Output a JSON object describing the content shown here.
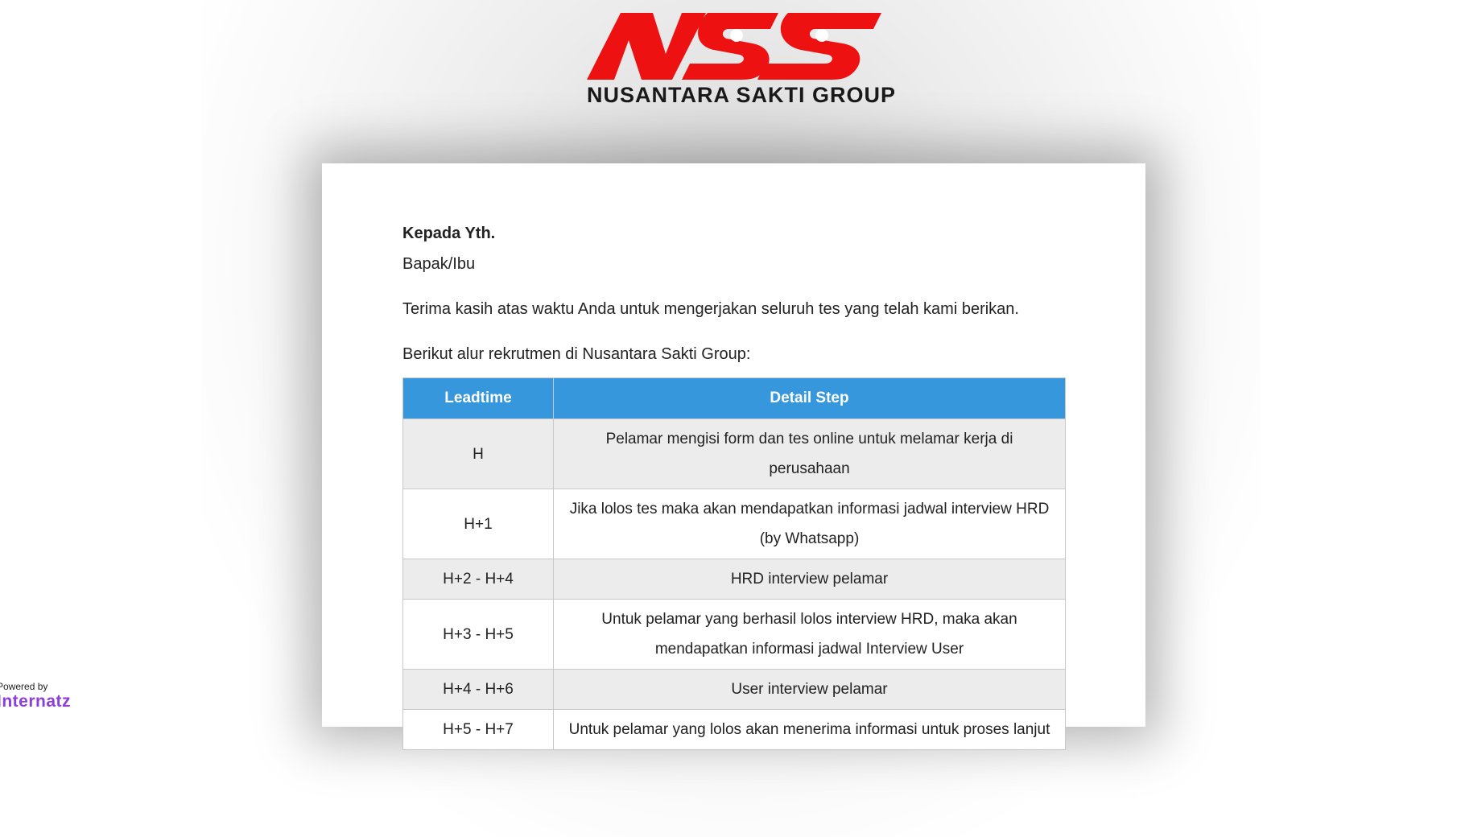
{
  "logo": {
    "mark": "NSS",
    "name": "NUSANTARA SAKTI GROUP",
    "color": "#ee1111"
  },
  "letter": {
    "greeting": "Kepada Yth.",
    "recipient": "Bapak/Ibu",
    "thanks": "Terima kasih atas waktu Anda untuk mengerjakan seluruh tes yang telah kami berikan.",
    "intro": "Berikut alur rekrutmen di Nusantara Sakti Group:"
  },
  "table": {
    "header_color": "#3797dc",
    "headers": [
      "Leadtime",
      "Detail Step"
    ],
    "rows": [
      {
        "leadtime": "H",
        "step": "Pelamar mengisi form dan tes online untuk melamar kerja di perusahaan"
      },
      {
        "leadtime": "H+1",
        "step": "Jika lolos tes maka akan mendapatkan informasi jadwal interview HRD (by Whatsapp)"
      },
      {
        "leadtime": "H+2 - H+4",
        "step": "HRD interview pelamar"
      },
      {
        "leadtime": "H+3 - H+5",
        "step": "Untuk pelamar yang berhasil lolos interview HRD, maka akan mendapatkan informasi jadwal Interview User"
      },
      {
        "leadtime": "H+4 - H+6",
        "step": "User interview pelamar"
      },
      {
        "leadtime": "H+5 - H+7",
        "step": "Untuk pelamar yang lolos akan menerima informasi untuk proses lanjut"
      }
    ]
  },
  "footer": {
    "powered_by": "Powered by",
    "brand": "Internatz",
    "brand_color": "#8b3fd8"
  }
}
